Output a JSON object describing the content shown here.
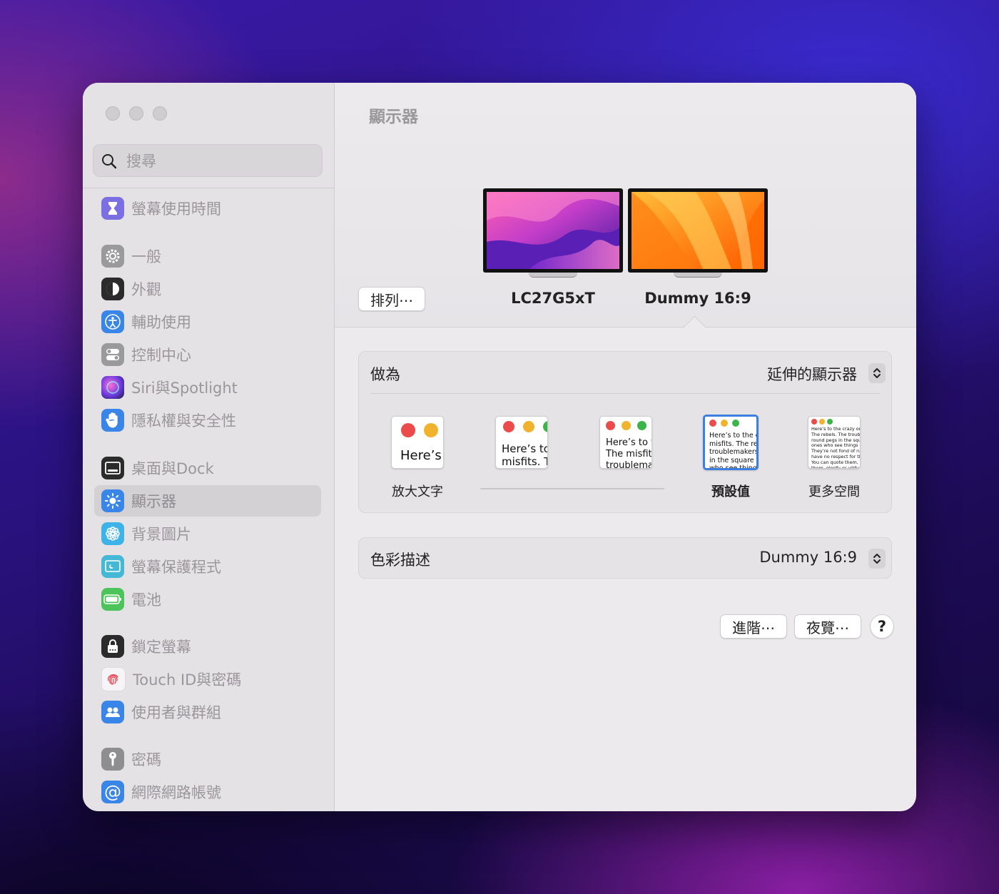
{
  "window": {
    "title": "顯示器"
  },
  "search": {
    "placeholder": "搜尋"
  },
  "sidebar": {
    "items": [
      {
        "label": "螢幕使用時間",
        "icon": "hourglass-icon",
        "color": "#7b6fe3"
      },
      {
        "label": "一般",
        "icon": "gear-icon",
        "color": "#9a999c"
      },
      {
        "label": "外觀",
        "icon": "appearance-icon",
        "color": "#2b2b2b"
      },
      {
        "label": "輔助使用",
        "icon": "accessibility-icon",
        "color": "#3a86e8"
      },
      {
        "label": "控制中心",
        "icon": "toggles-icon",
        "color": "#9a999c"
      },
      {
        "label": "Siri與Spotlight",
        "icon": "siri-icon",
        "color": "#c04fd6"
      },
      {
        "label": "隱私權與安全性",
        "icon": "hand-icon",
        "color": "#3a86e8"
      },
      {
        "label": "桌面與Dock",
        "icon": "dock-icon",
        "color": "#2b2b2b"
      },
      {
        "label": "顯示器",
        "icon": "sun-icon",
        "color": "#3a86e8",
        "active": true
      },
      {
        "label": "背景圖片",
        "icon": "flower-icon",
        "color": "#3eb3e8"
      },
      {
        "label": "螢幕保護程式",
        "icon": "screensaver-icon",
        "color": "#45b8d6"
      },
      {
        "label": "電池",
        "icon": "battery-icon",
        "color": "#4cc45a"
      },
      {
        "label": "鎖定螢幕",
        "icon": "lock-icon",
        "color": "#2b2b2b"
      },
      {
        "label": "Touch ID與密碼",
        "icon": "fingerprint-icon",
        "color": "#f6f4f6"
      },
      {
        "label": "使用者與群組",
        "icon": "users-icon",
        "color": "#3a86e8"
      },
      {
        "label": "密碼",
        "icon": "key-icon",
        "color": "#8e8d90"
      },
      {
        "label": "網際網路帳號",
        "icon": "at-icon",
        "color": "#3a86e8"
      }
    ]
  },
  "displays": {
    "arrange_label": "排列⋯",
    "monitors": [
      {
        "name": "LC27G5xT",
        "wallpaper": "monterey-purple"
      },
      {
        "name": "Dummy 16:9",
        "wallpaper": "ventura-orange",
        "selected": true
      }
    ]
  },
  "use_as": {
    "label": "做為",
    "value": "延伸的顯示器"
  },
  "resolution": {
    "sample_text": "Here’s to the crazy ones. The misfits. The rebels. The troublemakers. The round pegs in the square holes. The ones who see things differently. They’re not fond of rules. And they have no respect for the status quo. You can quote them, disagree with them, glorify or vilify them. About the only thing you can’t do is ignore them. Because they change things.",
    "options": [
      {
        "caption": "放大文字",
        "selected": false
      },
      {
        "caption": "",
        "selected": false
      },
      {
        "caption": "",
        "selected": false
      },
      {
        "caption": "預設值",
        "selected": true
      },
      {
        "caption": "更多空間",
        "selected": false
      }
    ]
  },
  "color_profile": {
    "label": "色彩描述",
    "value": "Dummy 16:9"
  },
  "buttons": {
    "advanced": "進階⋯",
    "night_shift": "夜覽⋯",
    "help": "?"
  }
}
